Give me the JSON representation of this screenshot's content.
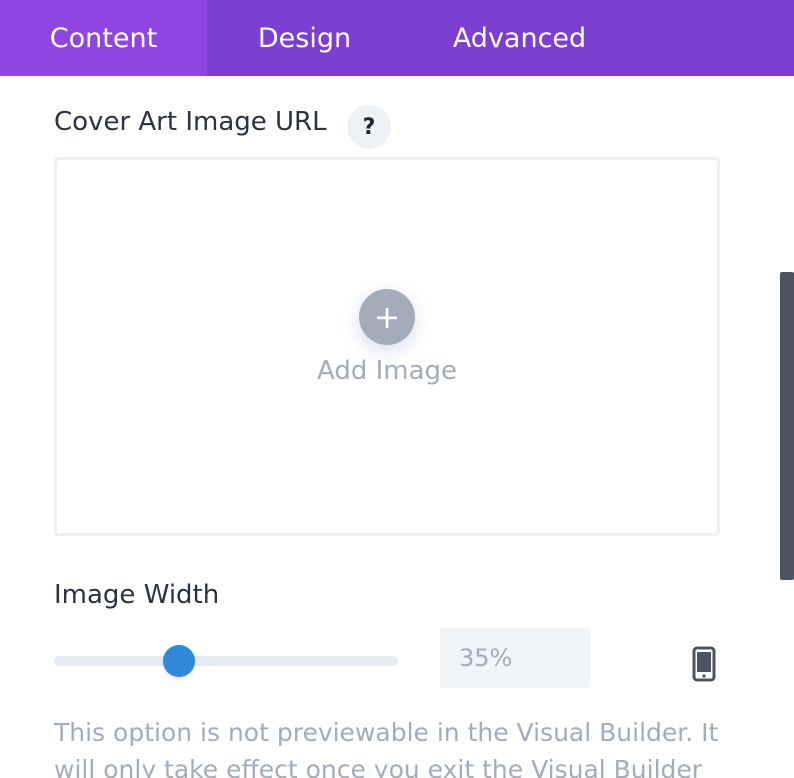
{
  "tabs": [
    {
      "label": "Content",
      "active": true
    },
    {
      "label": "Design",
      "active": false
    },
    {
      "label": "Advanced",
      "active": false
    }
  ],
  "cover_art": {
    "label": "Cover Art Image URL",
    "help_symbol": "?",
    "add_symbol": "+",
    "add_image_label": "Add Image"
  },
  "image_width": {
    "label": "Image Width",
    "value": "35%",
    "slider_fraction": 0.35,
    "device_icon": "phone-icon"
  },
  "help_text": "This option is not previewable in the Visual Builder. It will only take effect once you exit the Visual Builder",
  "colors": {
    "tab_bar": "#7d3fd0",
    "tab_active": "#8f45e0",
    "slider_thumb": "#2f88d8",
    "muted_text": "#a3acbb"
  }
}
